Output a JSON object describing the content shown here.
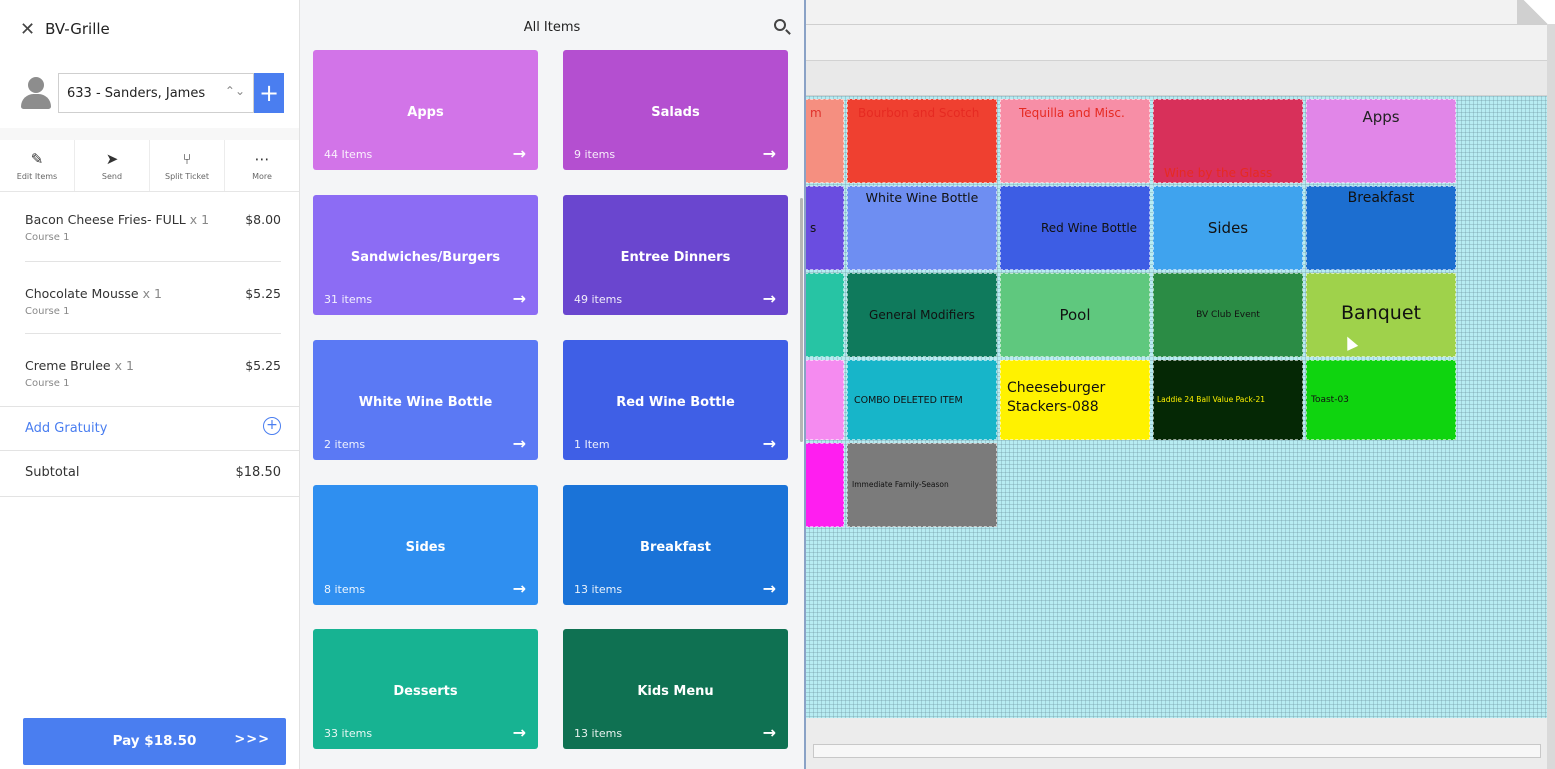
{
  "order_panel": {
    "venue": "BV-Grille",
    "customer": "633 - Sanders, James",
    "actions": [
      {
        "label": "Edit Items",
        "icon": "pencil-icon"
      },
      {
        "label": "Send",
        "icon": "send-icon"
      },
      {
        "label": "Split Ticket",
        "icon": "split-icon"
      },
      {
        "label": "More",
        "icon": "more-icon"
      }
    ],
    "lines": [
      {
        "name": "Bacon Cheese Fries- FULL",
        "qty": "x 1",
        "price": "$8.00",
        "course": "Course 1"
      },
      {
        "name": "Chocolate Mousse",
        "qty": "x 1",
        "price": "$5.25",
        "course": "Course 1"
      },
      {
        "name": "Creme Brulee",
        "qty": "x 1",
        "price": "$5.25",
        "course": "Course 1"
      }
    ],
    "gratuity_label": "Add Gratuity",
    "subtotal_label": "Subtotal",
    "subtotal_value": "$18.50",
    "pay_label": "Pay $18.50",
    "pay_arrows": ">>>"
  },
  "catalog": {
    "title": "All Items",
    "categories": [
      {
        "name": "Apps",
        "count": "44 Items",
        "color": "#d274e8"
      },
      {
        "name": "Salads",
        "count": "9 items",
        "color": "#b44fd0"
      },
      {
        "name": "Sandwiches/Burgers",
        "count": "31 items",
        "color": "#8c6cf4"
      },
      {
        "name": "Entree Dinners",
        "count": "49 items",
        "color": "#6a46cf"
      },
      {
        "name": "White Wine Bottle",
        "count": "2 items",
        "color": "#5b79f4"
      },
      {
        "name": "Red Wine Bottle",
        "count": "1 Item",
        "color": "#3f5fe6"
      },
      {
        "name": "Sides",
        "count": "8 items",
        "color": "#2f8ff0"
      },
      {
        "name": "Breakfast",
        "count": "13 items",
        "color": "#1a73d8"
      },
      {
        "name": "Desserts",
        "count": "33 items",
        "color": "#17b392"
      },
      {
        "name": "Kids Menu",
        "count": "13 items",
        "color": "#0f7152"
      }
    ]
  },
  "background_grid": {
    "tiles": [
      {
        "label": "m",
        "bg": "#f58f80",
        "color": "#e0312b"
      },
      {
        "label": "Bourbon and Scotch",
        "bg": "#ef4030",
        "color": "#e62a22"
      },
      {
        "label": "Tequilla and Misc.",
        "bg": "#f78ea6",
        "color": "#e62a22"
      },
      {
        "label": "Wine by the Glass",
        "bg": "#d8305a",
        "color": "#e62a22"
      },
      {
        "label": "Apps",
        "bg": "#e186e8",
        "color": "#222222"
      },
      {
        "label": "s",
        "bg": "#6a4de0",
        "color": "#111111"
      },
      {
        "label": "White Wine Bottle",
        "bg": "#6e8ef2",
        "color": "#111111"
      },
      {
        "label": "Red Wine Bottle",
        "bg": "#3d5de4",
        "color": "#111111"
      },
      {
        "label": "Sides",
        "bg": "#3fa3ee",
        "color": "#111111"
      },
      {
        "label": "Breakfast",
        "bg": "#1c6ed0",
        "color": "#111111"
      },
      {
        "label": "",
        "bg": "#27c4a4",
        "color": "#111111"
      },
      {
        "label": "General Modifiers",
        "bg": "#0f7a5c",
        "color": "#111111"
      },
      {
        "label": "Pool",
        "bg": "#5fc87e",
        "color": "#111111"
      },
      {
        "label": "BV Club Event",
        "bg": "#2b8c45",
        "color": "#111111"
      },
      {
        "label": "Banquet",
        "bg": "#9fd24b",
        "color": "#111111"
      },
      {
        "label": "",
        "bg": "#f58bf0",
        "color": "#111111"
      },
      {
        "label": "COMBO DELETED ITEM",
        "bg": "#17b5c9",
        "color": "#111111"
      },
      {
        "label": "Cheeseburger Stackers-088",
        "bg": "#fff200",
        "color": "#111111"
      },
      {
        "label": "Laddie 24 Ball Value Pack-21",
        "bg": "#052805",
        "color": "#fff200"
      },
      {
        "label": "Toast-03",
        "bg": "#0fd40f",
        "color": "#111111"
      },
      {
        "label": "",
        "bg": "#ff1ef0",
        "color": "#111111"
      },
      {
        "label": "Immediate Family-Season",
        "bg": "#7b7b7b",
        "color": "#111111"
      }
    ]
  }
}
